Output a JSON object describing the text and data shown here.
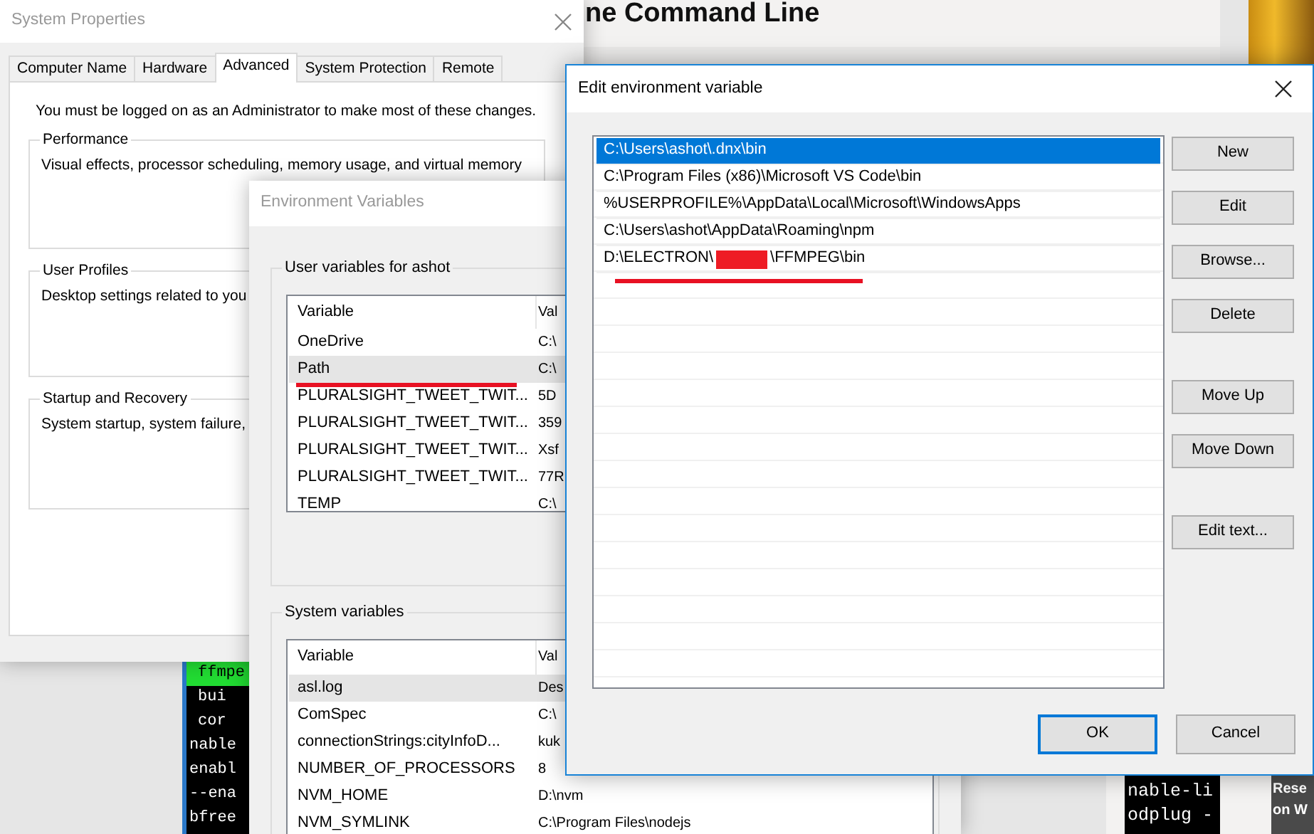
{
  "background_page": {
    "heading": "ne Command Line",
    "terminal_left": [
      {
        "text": "ffmpe",
        "highlighted": true,
        "indented": true
      },
      {
        "text": "bui",
        "highlighted": false,
        "indented": true
      },
      {
        "text": "cor",
        "highlighted": false,
        "indented": true
      },
      {
        "text": "nable",
        "highlighted": false,
        "indented": false
      },
      {
        "text": "enabl",
        "highlighted": false,
        "indented": false
      },
      {
        "text": "--ena",
        "highlighted": false,
        "indented": false
      },
      {
        "text": "bfree",
        "highlighted": false,
        "indented": false
      }
    ],
    "terminal_right": [
      "nable-li",
      "odplug -"
    ],
    "card_caption": [
      "Rese",
      "on W"
    ]
  },
  "system_properties": {
    "title": "System Properties",
    "tabs": [
      {
        "label": "Computer Name",
        "selected": false
      },
      {
        "label": "Hardware",
        "selected": false
      },
      {
        "label": "Advanced",
        "selected": true
      },
      {
        "label": "System Protection",
        "selected": false
      },
      {
        "label": "Remote",
        "selected": false
      }
    ],
    "notice": "You must be logged on as an Administrator to make most of these changes.",
    "groups": [
      {
        "title": "Performance",
        "description": "Visual effects, processor scheduling, memory usage, and virtual memory"
      },
      {
        "title": "User Profiles",
        "description": "Desktop settings related to you"
      },
      {
        "title": "Startup and Recovery",
        "description": "System startup, system failure,"
      }
    ]
  },
  "environment_variables": {
    "title": "Environment Variables",
    "user_variables": {
      "title": "User variables for ashot",
      "columns": [
        "Variable",
        "Val"
      ],
      "rows": [
        {
          "variable": "OneDrive",
          "value": "C:\\",
          "selected": false,
          "marked": false
        },
        {
          "variable": "Path",
          "value": "C:\\",
          "selected": true,
          "marked": true
        },
        {
          "variable": "PLURALSIGHT_TWEET_TWIT...",
          "value": "5D",
          "selected": false,
          "marked": false
        },
        {
          "variable": "PLURALSIGHT_TWEET_TWIT...",
          "value": "359",
          "selected": false,
          "marked": false
        },
        {
          "variable": "PLURALSIGHT_TWEET_TWIT...",
          "value": "Xsf",
          "selected": false,
          "marked": false
        },
        {
          "variable": "PLURALSIGHT_TWEET_TWIT...",
          "value": "77R",
          "selected": false,
          "marked": false
        },
        {
          "variable": "TEMP",
          "value": "C:\\",
          "selected": false,
          "marked": false
        }
      ]
    },
    "system_variables": {
      "title": "System variables",
      "columns": [
        "Variable",
        "Val"
      ],
      "rows": [
        {
          "variable": "asl.log",
          "value": "Des",
          "selected": true,
          "marked": false
        },
        {
          "variable": "ComSpec",
          "value": "C:\\",
          "selected": false,
          "marked": false
        },
        {
          "variable": "connectionStrings:cityInfoD...",
          "value": "kuk",
          "selected": false,
          "marked": false
        },
        {
          "variable": "NUMBER_OF_PROCESSORS",
          "value": "8",
          "selected": false,
          "marked": false
        },
        {
          "variable": "NVM_HOME",
          "value": "D:\\nvm",
          "selected": false,
          "marked": false
        },
        {
          "variable": "NVM_SYMLINK",
          "value": "C:\\Program Files\\nodejs",
          "selected": false,
          "marked": false
        }
      ]
    }
  },
  "edit_environment_variable": {
    "title": "Edit environment variable",
    "entries": [
      {
        "kind": "plain",
        "text": "C:\\Users\\ashot\\.dnx\\bin",
        "selected": true,
        "marked": false
      },
      {
        "kind": "plain",
        "text": "C:\\Program Files (x86)\\Microsoft VS Code\\bin",
        "selected": false,
        "marked": false
      },
      {
        "kind": "plain",
        "text": "%USERPROFILE%\\AppData\\Local\\Microsoft\\WindowsApps",
        "selected": false,
        "marked": false
      },
      {
        "kind": "plain",
        "text": "C:\\Users\\ashot\\AppData\\Roaming\\npm",
        "selected": false,
        "marked": false
      },
      {
        "kind": "redacted",
        "text": "D:\\ELECTRON\\",
        "text_after": "\\FFMPEG\\bin",
        "selected": false,
        "marked": true
      }
    ],
    "side_button_groups": [
      [
        "New",
        "Edit",
        "Browse...",
        "Delete"
      ],
      [
        "Move Up",
        "Move Down"
      ],
      [
        "Edit text..."
      ]
    ],
    "footer_buttons": [
      {
        "label": "OK",
        "default": true
      },
      {
        "label": "Cancel",
        "default": false
      }
    ]
  }
}
